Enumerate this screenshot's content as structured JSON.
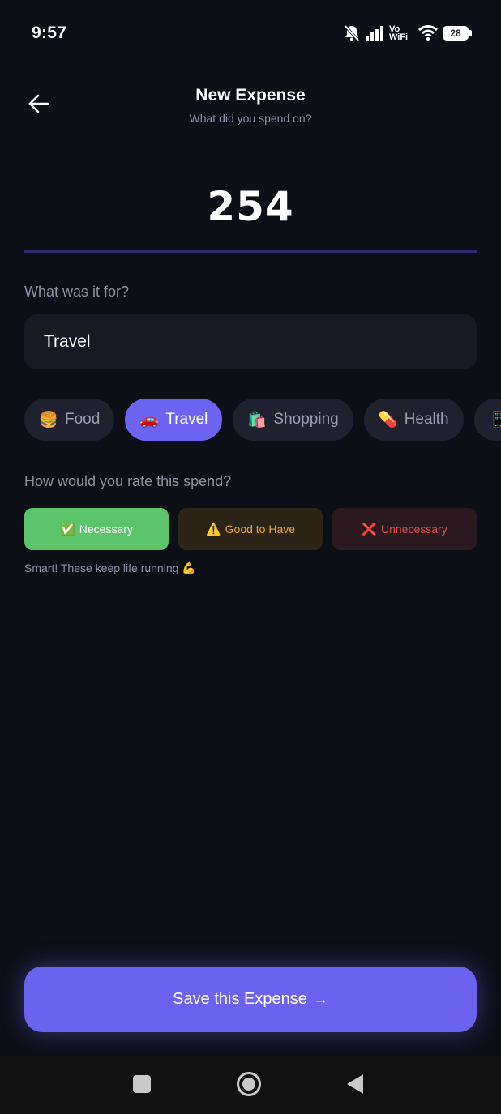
{
  "status_bar": {
    "time": "9:57",
    "vowifi_top": "Vo",
    "vowifi_bottom": "WiFi",
    "battery": "28",
    "icons": [
      "notifications-off-icon",
      "signal-icon",
      "vowifi-icon",
      "wifi-icon",
      "battery-icon"
    ]
  },
  "header": {
    "title": "New Expense",
    "subtitle": "What did you spend on?",
    "back_icon": "arrow-left-icon"
  },
  "amount": {
    "value": "254"
  },
  "description": {
    "label": "What was it for?",
    "value": "Travel"
  },
  "categories": [
    {
      "emoji": "🍔",
      "label": "Food",
      "active": false
    },
    {
      "emoji": "🚗",
      "label": "Travel",
      "active": true
    },
    {
      "emoji": "🛍️",
      "label": "Shopping",
      "active": false
    },
    {
      "emoji": "💊",
      "label": "Health",
      "active": false
    },
    {
      "emoji": "📱",
      "label": "",
      "active": false
    }
  ],
  "rating": {
    "label": "How would you rate this spend?",
    "options": [
      {
        "emoji": "✅",
        "label": "Necessary",
        "selected": true
      },
      {
        "emoji": "⚠️",
        "label": "Good to Have",
        "selected": false
      },
      {
        "emoji": "❌",
        "label": "Unnecessary",
        "selected": false
      }
    ],
    "hint": "Smart! These keep life running 💪"
  },
  "save_button": {
    "label": "Save this Expense",
    "arrow": "→"
  },
  "nav_bar": {
    "icons": [
      "recents-square-icon",
      "home-circle-icon",
      "back-triangle-icon"
    ]
  },
  "colors": {
    "background": "#0d0f17",
    "accent": "#6b63f0",
    "necessary": "#5cc46a",
    "good_to_have": "#e6a53a",
    "unnecessary": "#d84a4a"
  }
}
